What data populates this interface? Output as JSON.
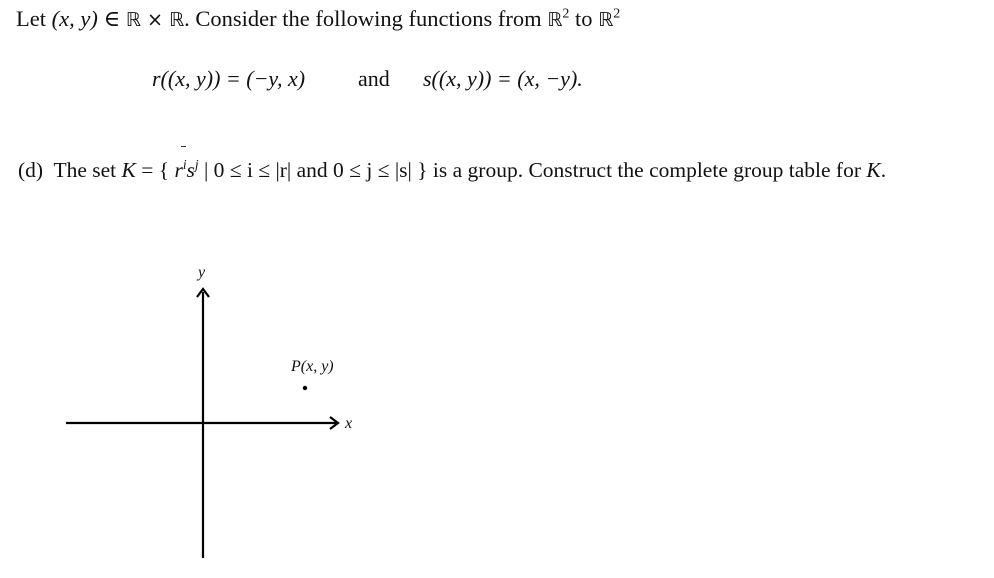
{
  "intro": {
    "text_prefix": "Let ",
    "pair": "(x, y)",
    "membership": " ∈ ",
    "set_product": "ℝ × ℝ",
    "text_middle": ". Consider the following functions from ",
    "domain_set": "ℝ",
    "domain_exp": "2",
    "to_word": " to ",
    "codomain_set": "ℝ",
    "codomain_exp": "2"
  },
  "functions": {
    "r_definition": "r((x, y)) = (−y, x)",
    "connector": "and",
    "s_definition": "s((x, y)) = (x, −y)."
  },
  "part_d": {
    "label": "(d)",
    "text_prefix": "The set ",
    "set_name": "K",
    "set_builder_open": " = { ",
    "element_r": "r",
    "exp_i": "i",
    "element_s": "s",
    "exp_j": "j",
    "condition": "  |  0 ≤ i ≤ |r| and 0 ≤ j ≤ |s| }",
    "text_suffix": " is a group. Construct the complete group table for ",
    "set_name_end": "K",
    "period": "."
  },
  "diagram": {
    "x_axis_label": "x",
    "y_axis_label": "y",
    "point_label": "P(x, y)",
    "colors": {
      "axes": "#000000",
      "point": "#000000"
    }
  }
}
